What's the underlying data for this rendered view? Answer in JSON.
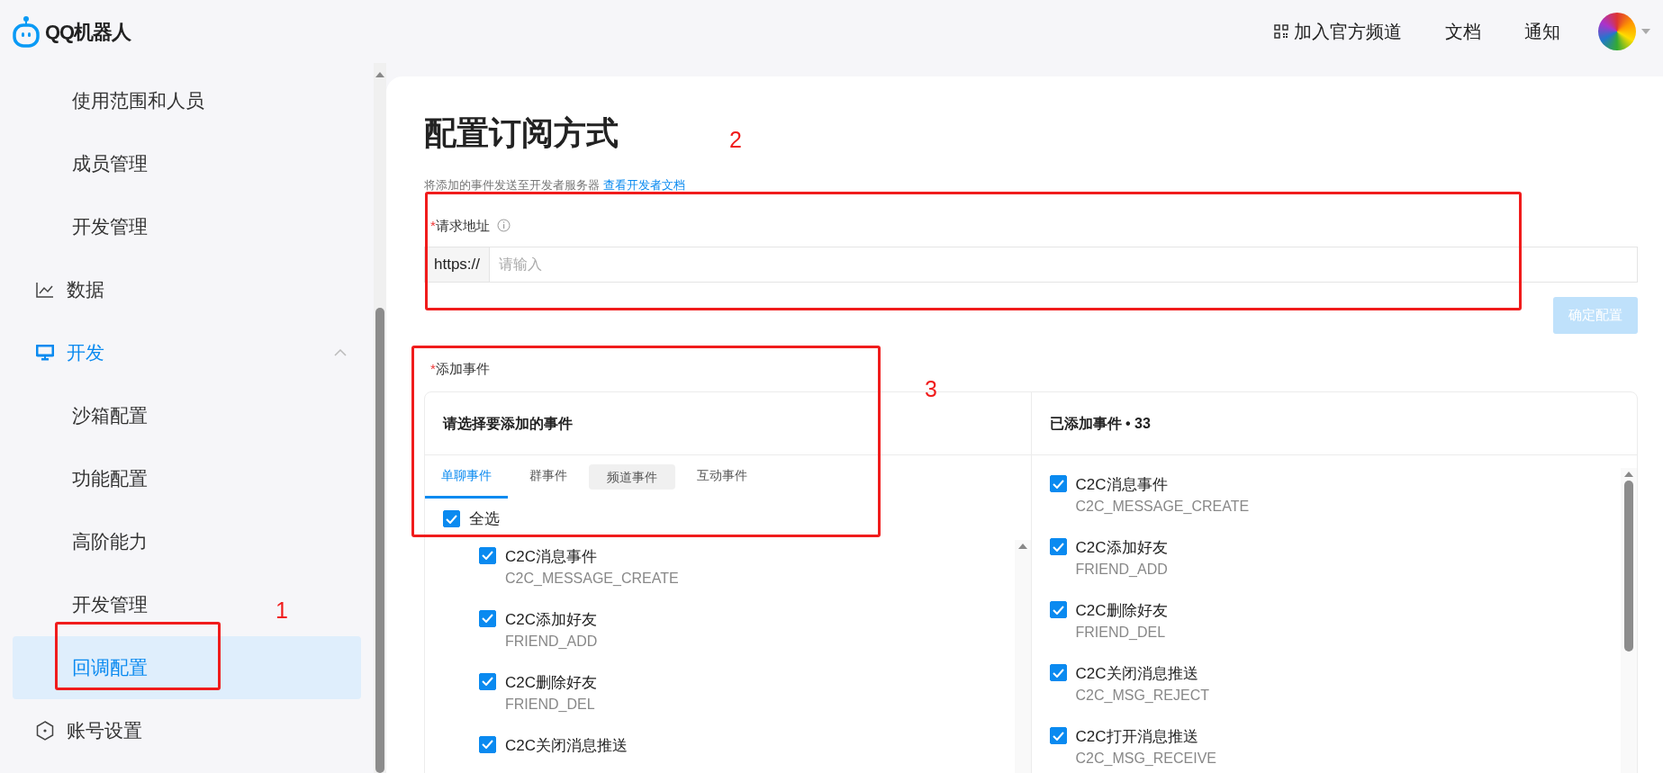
{
  "header": {
    "logo_text": "QQ机器人",
    "nav": [
      {
        "label": "加入官方频道",
        "kind": "iconed"
      },
      {
        "label": "文档",
        "kind": "plain"
      },
      {
        "label": "通知",
        "kind": "plain"
      }
    ]
  },
  "sidebar": {
    "items": [
      {
        "kind": "sub",
        "label": "使用范围和人员",
        "selected": false
      },
      {
        "kind": "sub",
        "label": "成员管理",
        "selected": false
      },
      {
        "kind": "sub",
        "label": "开发管理",
        "selected": false
      },
      {
        "kind": "group",
        "label": "数据",
        "active": false
      },
      {
        "kind": "group",
        "label": "开发",
        "active": true,
        "expanded": true,
        "children": [
          {
            "label": "沙箱配置",
            "selected": false
          },
          {
            "label": "功能配置",
            "selected": false
          },
          {
            "label": "高阶能力",
            "selected": false
          },
          {
            "label": "开发管理",
            "selected": false
          },
          {
            "label": "回调配置",
            "selected": true
          }
        ]
      },
      {
        "kind": "group",
        "label": "账号设置",
        "active": false
      }
    ]
  },
  "main": {
    "title": "配置订阅方式",
    "subtitle": "将添加的事件发送至开发者服务器",
    "doc_link": "查看开发者文档",
    "url_field": {
      "label": "请求地址",
      "required": true,
      "required_mark": "*",
      "prefix": "https://",
      "placeholder": "请输入"
    },
    "confirm_button": {
      "label": "确定配置",
      "disabled": true
    },
    "events_label": {
      "label": "添加事件",
      "required": true,
      "required_mark": "*"
    },
    "left_panel": {
      "title": "请选择要添加的事件",
      "tabs": [
        {
          "label": "单聊事件",
          "selected": true,
          "hovered": false
        },
        {
          "label": "群事件",
          "selected": false,
          "hovered": false
        },
        {
          "label": "频道事件",
          "selected": false,
          "hovered": true
        },
        {
          "label": "互动事件",
          "selected": false,
          "hovered": false
        }
      ],
      "select_all": {
        "label": "全选",
        "checked": true
      },
      "events": [
        {
          "name": "C2C消息事件",
          "code": "C2C_MESSAGE_CREATE",
          "checked": true
        },
        {
          "name": "C2C添加好友",
          "code": "FRIEND_ADD",
          "checked": true
        },
        {
          "name": "C2C删除好友",
          "code": "FRIEND_DEL",
          "checked": true
        },
        {
          "name": "C2C关闭消息推送",
          "checked": true
        }
      ]
    },
    "right_panel": {
      "title": "已添加事件 • 33",
      "events": [
        {
          "name": "C2C消息事件",
          "code": "C2C_MESSAGE_CREATE",
          "checked": true
        },
        {
          "name": "C2C添加好友",
          "code": "FRIEND_ADD",
          "checked": true
        },
        {
          "name": "C2C删除好友",
          "code": "FRIEND_DEL",
          "checked": true
        },
        {
          "name": "C2C关闭消息推送",
          "code": "C2C_MSG_REJECT",
          "checked": true
        },
        {
          "name": "C2C打开消息推送",
          "code": "C2C_MSG_RECEIVE",
          "checked": true
        }
      ]
    }
  },
  "annotations": [
    {
      "label": "1"
    },
    {
      "label": "2"
    },
    {
      "label": "3"
    }
  ]
}
